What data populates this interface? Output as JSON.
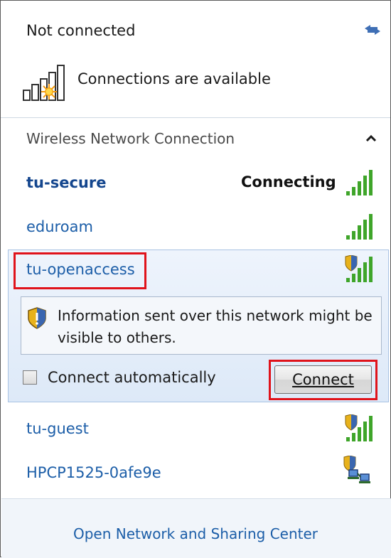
{
  "header": {
    "status_title": "Not connected",
    "connections_text": "Connections are available"
  },
  "section": {
    "title": "Wireless Network Connection"
  },
  "networks": [
    {
      "name": "tu-secure",
      "status": "Connecting",
      "secured": false,
      "signal_bars": 5
    },
    {
      "name": "eduroam",
      "status": "",
      "secured": false,
      "signal_bars": 5
    },
    {
      "name": "tu-openaccess",
      "status": "",
      "secured": true,
      "selected": true,
      "signal_bars": 5
    },
    {
      "name": "tu-guest",
      "status": "",
      "secured": true,
      "signal_bars": 5
    },
    {
      "name": "HPCP1525-0afe9e",
      "status": "",
      "secured": true,
      "type": "ad-hoc"
    }
  ],
  "warning": {
    "text": "Information sent over this network might be visible to others."
  },
  "connect_auto": {
    "label": "Connect automatically",
    "checked": false
  },
  "connect_button": {
    "label": "Connect"
  },
  "footer": {
    "link": "Open Network and Sharing Center"
  },
  "colors": {
    "link_blue": "#1c5ea8",
    "highlight_red": "#e0131b",
    "signal_green": "#3fa52a",
    "shield_yellow": "#e8b21c"
  },
  "icons": [
    "refresh-icon",
    "wireless-unavailable-icon",
    "collapse-chevron-icon",
    "signal-bars-icon",
    "shield-icon",
    "ad-hoc-network-icon"
  ]
}
